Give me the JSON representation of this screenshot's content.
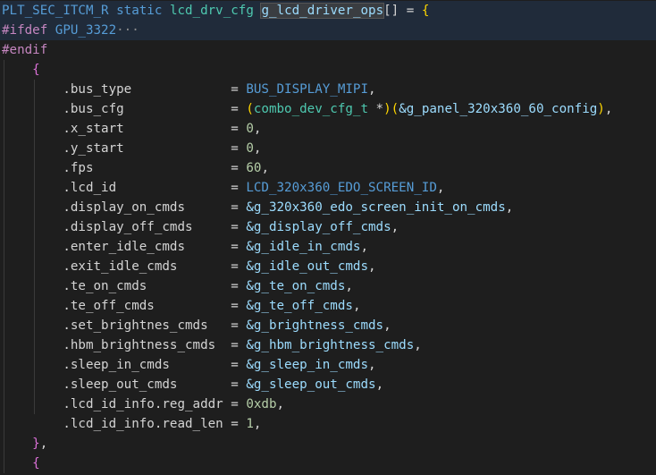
{
  "colors": {
    "background": "#1e1e1e",
    "macro": "#4fc1ff",
    "keyword": "#569cd6",
    "type": "#4ec9b0",
    "identifier": "#9cdcfe",
    "plain": "#d4d4d4",
    "number": "#b5cea8",
    "preprocessor": "#c586c0",
    "brace_gold": "#ffd700",
    "brace_purple": "#da70d6",
    "inactive_region": "#202b3a"
  },
  "lines": [
    [
      {
        "t": "PLT_SEC_ITCM_R",
        "c": "#569cd6"
      },
      {
        "t": " "
      },
      {
        "t": "static",
        "c": "#569cd6"
      },
      {
        "t": " "
      },
      {
        "t": "lcd_drv_cfg",
        "c": "#4ec9b0"
      },
      {
        "t": " "
      },
      {
        "t": "g_lcd_driver_ops",
        "c": "#9cdcfe",
        "hl": true
      },
      {
        "t": "[]",
        "c": "#d4d4d4"
      },
      {
        "t": " = "
      },
      {
        "t": "{",
        "c": "#ffd700"
      }
    ],
    [
      {
        "t": "#ifdef",
        "c": "#c586c0"
      },
      {
        "t": " "
      },
      {
        "t": "GPU_3322",
        "c": "#569cd6"
      },
      {
        "t": "···",
        "c": "#8c8c8c",
        "cls": "ellipsis-marker"
      }
    ],
    [
      {
        "t": "#endif",
        "c": "#c586c0"
      }
    ],
    [
      {
        "t": "    "
      },
      {
        "t": "{",
        "c": "#da70d6"
      }
    ],
    [
      {
        "t": "        .bus_type             = "
      },
      {
        "t": "BUS_DISPLAY_MIPI",
        "c": "#569cd6"
      },
      {
        "t": ","
      }
    ],
    [
      {
        "t": "        .bus_cfg              = "
      },
      {
        "t": "(",
        "c": "#ffd700"
      },
      {
        "t": "combo_dev_cfg_t",
        "c": "#4ec9b0"
      },
      {
        "t": " *"
      },
      {
        "t": ")",
        "c": "#ffd700"
      },
      {
        "t": "(",
        "c": "#ffd700"
      },
      {
        "t": "&g_panel_320x360_60_config",
        "c": "#9cdcfe"
      },
      {
        "t": ")",
        "c": "#ffd700"
      },
      {
        "t": ","
      }
    ],
    [
      {
        "t": "        .x_start              = "
      },
      {
        "t": "0",
        "c": "#b5cea8"
      },
      {
        "t": ","
      }
    ],
    [
      {
        "t": "        .y_start              = "
      },
      {
        "t": "0",
        "c": "#b5cea8"
      },
      {
        "t": ","
      }
    ],
    [
      {
        "t": "        .fps                  = "
      },
      {
        "t": "60",
        "c": "#b5cea8"
      },
      {
        "t": ","
      }
    ],
    [
      {
        "t": "        .lcd_id               = "
      },
      {
        "t": "LCD_320x360_EDO_SCREEN_ID",
        "c": "#569cd6"
      },
      {
        "t": ","
      }
    ],
    [
      {
        "t": "        .display_on_cmds      = "
      },
      {
        "t": "&g_320x360_edo_screen_init_on_cmds",
        "c": "#9cdcfe"
      },
      {
        "t": ","
      }
    ],
    [
      {
        "t": "        .display_off_cmds     = "
      },
      {
        "t": "&g_display_off_cmds",
        "c": "#9cdcfe"
      },
      {
        "t": ","
      }
    ],
    [
      {
        "t": "        .enter_idle_cmds      = "
      },
      {
        "t": "&g_idle_in_cmds",
        "c": "#9cdcfe"
      },
      {
        "t": ","
      }
    ],
    [
      {
        "t": "        .exit_idle_cmds       = "
      },
      {
        "t": "&g_idle_out_cmds",
        "c": "#9cdcfe"
      },
      {
        "t": ","
      }
    ],
    [
      {
        "t": "        .te_on_cmds           = "
      },
      {
        "t": "&g_te_on_cmds",
        "c": "#9cdcfe"
      },
      {
        "t": ","
      }
    ],
    [
      {
        "t": "        .te_off_cmds          = "
      },
      {
        "t": "&g_te_off_cmds",
        "c": "#9cdcfe"
      },
      {
        "t": ","
      }
    ],
    [
      {
        "t": "        .set_brightnes_cmds   = "
      },
      {
        "t": "&g_brightness_cmds",
        "c": "#9cdcfe"
      },
      {
        "t": ","
      }
    ],
    [
      {
        "t": "        .hbm_brightness_cmds  = "
      },
      {
        "t": "&g_hbm_brightness_cmds",
        "c": "#9cdcfe"
      },
      {
        "t": ","
      }
    ],
    [
      {
        "t": "        .sleep_in_cmds        = "
      },
      {
        "t": "&g_sleep_in_cmds",
        "c": "#9cdcfe"
      },
      {
        "t": ","
      }
    ],
    [
      {
        "t": "        .sleep_out_cmds       = "
      },
      {
        "t": "&g_sleep_out_cmds",
        "c": "#9cdcfe"
      },
      {
        "t": ","
      }
    ],
    [
      {
        "t": "        .lcd_id_info.reg_addr = "
      },
      {
        "t": "0xdb",
        "c": "#b5cea8"
      },
      {
        "t": ","
      }
    ],
    [
      {
        "t": "        .lcd_id_info.read_len = "
      },
      {
        "t": "1",
        "c": "#b5cea8"
      },
      {
        "t": ","
      }
    ],
    [
      {
        "t": "    "
      },
      {
        "t": "}",
        "c": "#da70d6"
      },
      {
        "t": ","
      }
    ],
    [
      {
        "t": "    "
      },
      {
        "t": "{",
        "c": "#da70d6"
      }
    ]
  ],
  "highlighted_lines": [
    0,
    1
  ]
}
